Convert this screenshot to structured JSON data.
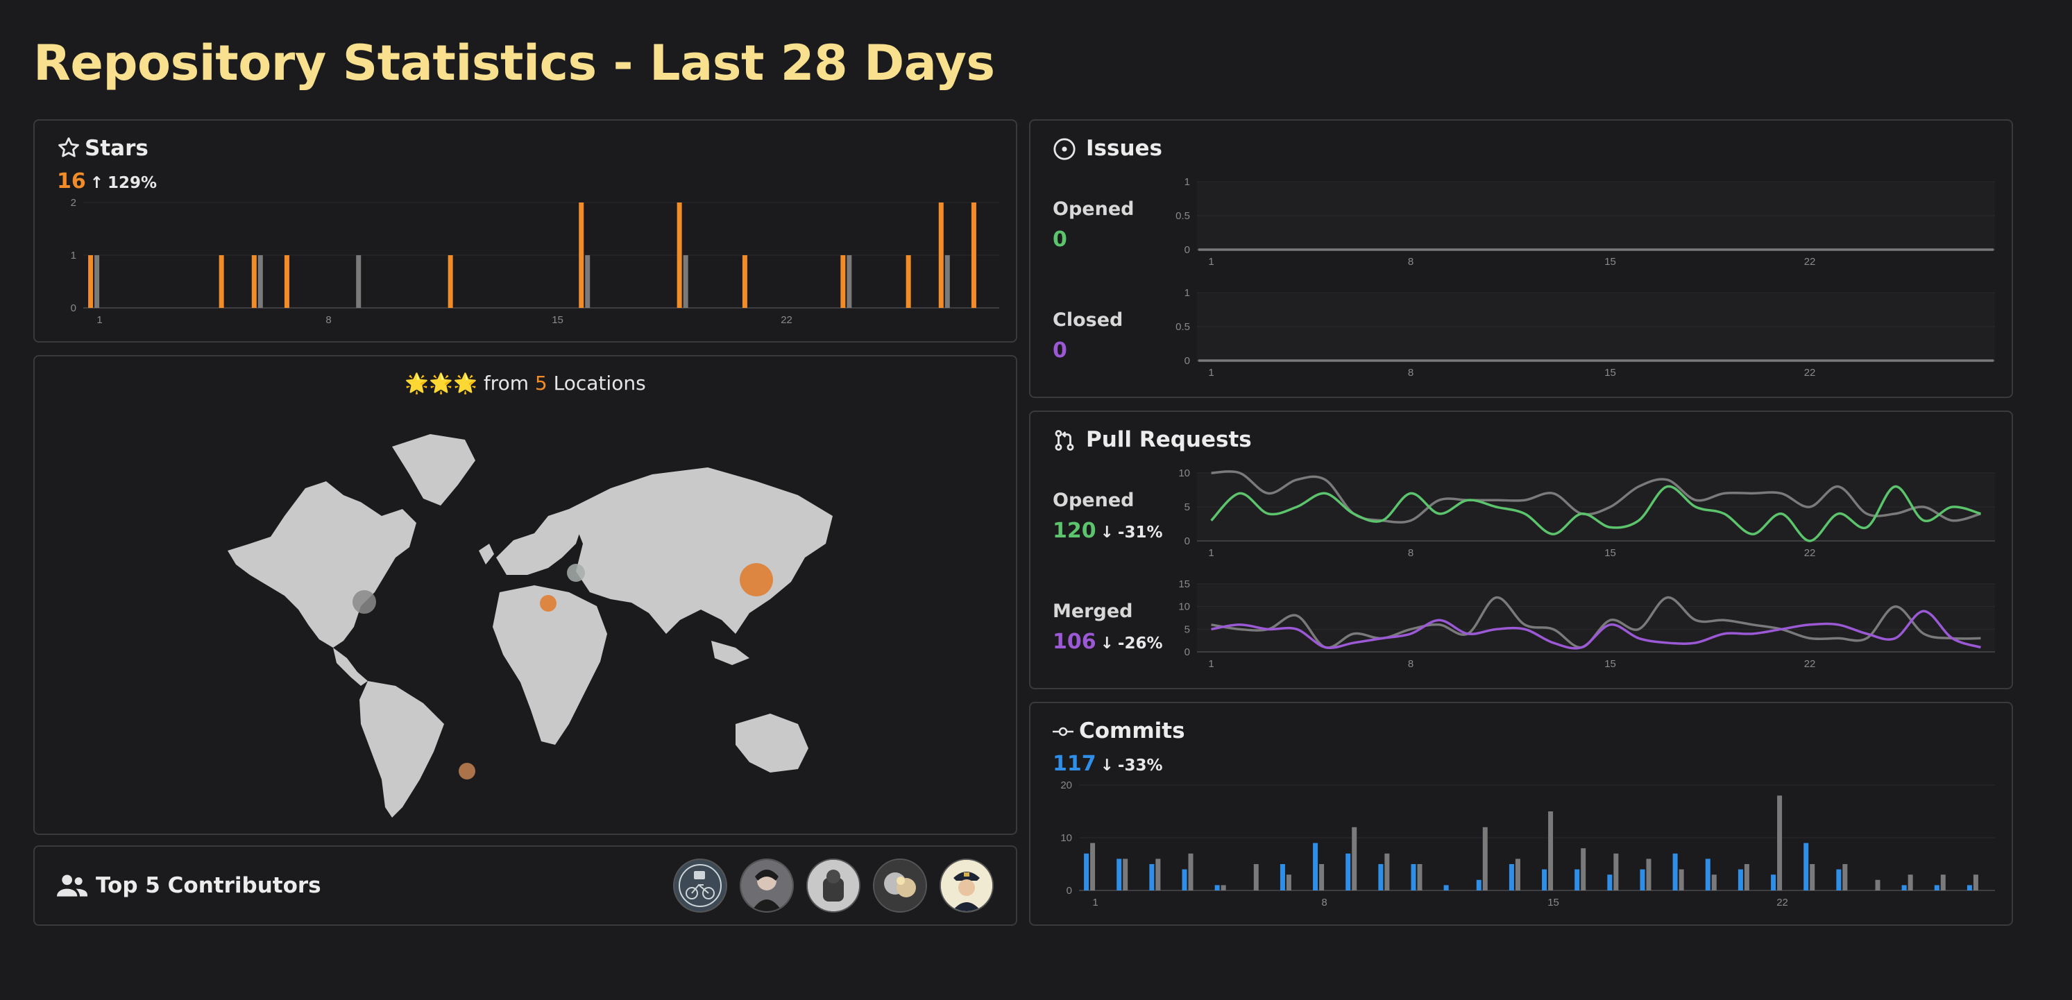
{
  "page": {
    "title": "Repository Statistics - Last 28 Days"
  },
  "colors": {
    "orange": "#f28c28",
    "gray": "#7a7a7a",
    "green": "#5cc46c",
    "purple": "#9b59d6",
    "blue": "#2f8ee8",
    "title": "#f8e08e"
  },
  "stars": {
    "title": "Stars",
    "icon": "star-icon",
    "value": "16",
    "change": "129%",
    "direction": "up",
    "y_ticks": [
      "0",
      "1",
      "2"
    ],
    "x_ticks": [
      "1",
      "8",
      "15",
      "22"
    ]
  },
  "map": {
    "headline_prefix": "from",
    "count": "5",
    "headline_suffix": "Locations",
    "emoji": "🌟🌟🌟"
  },
  "contributors": {
    "title": "Top 5 Contributors",
    "icon": "people-icon",
    "avatars": [
      "avatar-1",
      "avatar-2",
      "avatar-3",
      "avatar-4",
      "avatar-5"
    ]
  },
  "issues": {
    "title": "Issues",
    "icon": "issue-icon",
    "opened_label": "Opened",
    "opened_value": "0",
    "closed_label": "Closed",
    "closed_value": "0",
    "y_ticks": [
      "0",
      "0.5",
      "1"
    ],
    "x_ticks": [
      "1",
      "8",
      "15",
      "22"
    ]
  },
  "pulls": {
    "title": "Pull Requests",
    "icon": "pull-request-icon",
    "opened_label": "Opened",
    "opened_value": "120",
    "opened_change": "-31%",
    "opened_direction": "down",
    "merged_label": "Merged",
    "merged_value": "106",
    "merged_change": "-26%",
    "merged_direction": "down",
    "opened_y_ticks": [
      "0",
      "5",
      "10"
    ],
    "merged_y_ticks": [
      "0",
      "5",
      "10",
      "15"
    ],
    "x_ticks": [
      "1",
      "8",
      "15",
      "22"
    ]
  },
  "commits": {
    "title": "Commits",
    "icon": "commit-icon",
    "value": "117",
    "change": "-33%",
    "direction": "down",
    "y_ticks": [
      "0",
      "10",
      "20"
    ],
    "x_ticks": [
      "1",
      "8",
      "15",
      "22"
    ]
  },
  "chart_data": [
    {
      "type": "bar",
      "title": "Stars",
      "x": [
        1,
        2,
        3,
        4,
        5,
        6,
        7,
        8,
        9,
        10,
        11,
        12,
        13,
        14,
        15,
        16,
        17,
        18,
        19,
        20,
        21,
        22,
        23,
        24,
        25,
        26,
        27,
        28
      ],
      "series": [
        {
          "values": [
            1,
            0,
            0,
            0,
            1,
            1,
            1,
            0,
            0,
            0,
            0,
            1,
            0,
            0,
            0,
            2,
            0,
            0,
            2,
            0,
            1,
            0,
            0,
            1,
            0,
            1,
            2,
            2
          ]
        },
        {
          "values": [
            1,
            0,
            0,
            0,
            0,
            1,
            0,
            0,
            1,
            0,
            0,
            0,
            0,
            0,
            0,
            1,
            0,
            0,
            1,
            0,
            0,
            0,
            0,
            1,
            0,
            0,
            1,
            0
          ]
        }
      ],
      "ylim": [
        0,
        2
      ]
    },
    {
      "type": "line",
      "title": "Issues Opened",
      "x": [
        1,
        28
      ],
      "series": [
        {
          "values": [
            0,
            0
          ]
        }
      ],
      "ylim": [
        0,
        1
      ]
    },
    {
      "type": "line",
      "title": "Issues Closed",
      "x": [
        1,
        28
      ],
      "series": [
        {
          "values": [
            0,
            0
          ]
        }
      ],
      "ylim": [
        0,
        1
      ]
    },
    {
      "type": "line",
      "title": "Pull Requests Opened",
      "x": [
        1,
        2,
        3,
        4,
        5,
        6,
        7,
        8,
        9,
        10,
        11,
        12,
        13,
        14,
        15,
        16,
        17,
        18,
        19,
        20,
        21,
        22,
        23,
        24,
        25,
        26,
        27,
        28
      ],
      "series": [
        {
          "values": [
            3,
            7,
            4,
            5,
            7,
            4,
            3,
            7,
            4,
            6,
            5,
            4,
            1,
            4,
            2,
            3,
            8,
            5,
            4,
            1,
            4,
            0,
            4,
            2,
            8,
            3,
            5,
            4
          ]
        },
        {
          "values": [
            10,
            10,
            7,
            9,
            9,
            4,
            3,
            3,
            6,
            6,
            6,
            6,
            7,
            4,
            5,
            8,
            9,
            6,
            7,
            7,
            7,
            5,
            8,
            4,
            4,
            5,
            3,
            4
          ]
        }
      ],
      "ylim": [
        0,
        10
      ]
    },
    {
      "type": "line",
      "title": "Pull Requests Merged",
      "x": [
        1,
        2,
        3,
        4,
        5,
        6,
        7,
        8,
        9,
        10,
        11,
        12,
        13,
        14,
        15,
        16,
        17,
        18,
        19,
        20,
        21,
        22,
        23,
        24,
        25,
        26,
        27,
        28
      ],
      "series": [
        {
          "values": [
            5,
            6,
            5,
            5,
            1,
            2,
            3,
            4,
            7,
            4,
            5,
            5,
            2,
            1,
            6,
            3,
            2,
            2,
            4,
            4,
            5,
            6,
            6,
            4,
            3,
            9,
            3,
            1
          ]
        },
        {
          "values": [
            6,
            5,
            5,
            8,
            1,
            4,
            3,
            5,
            6,
            4,
            12,
            6,
            5,
            1,
            7,
            5,
            12,
            7,
            7,
            6,
            5,
            3,
            3,
            3,
            10,
            4,
            3,
            3
          ]
        }
      ],
      "ylim": [
        0,
        15
      ]
    },
    {
      "type": "bar",
      "title": "Commits",
      "x": [
        1,
        2,
        3,
        4,
        5,
        6,
        7,
        8,
        9,
        10,
        11,
        12,
        13,
        14,
        15,
        16,
        17,
        18,
        19,
        20,
        21,
        22,
        23,
        24,
        25,
        26,
        27,
        28
      ],
      "series": [
        {
          "values": [
            7,
            6,
            5,
            4,
            1,
            0,
            5,
            9,
            7,
            5,
            5,
            1,
            2,
            5,
            4,
            4,
            3,
            4,
            7,
            6,
            4,
            3,
            9,
            4,
            0,
            1,
            1,
            1
          ]
        },
        {
          "values": [
            9,
            6,
            6,
            7,
            1,
            5,
            3,
            5,
            12,
            7,
            5,
            0,
            12,
            6,
            15,
            8,
            7,
            6,
            4,
            3,
            5,
            18,
            5,
            5,
            2,
            3,
            3,
            3
          ]
        }
      ],
      "ylim": [
        0,
        20
      ]
    }
  ]
}
